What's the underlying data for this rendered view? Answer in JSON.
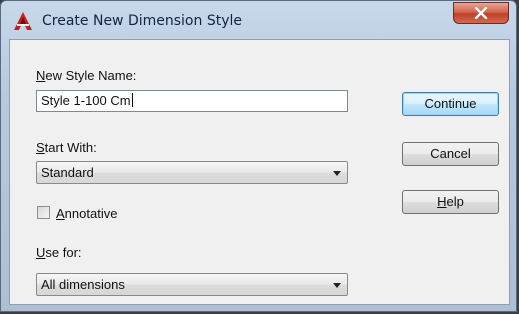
{
  "window": {
    "title": "Create New Dimension Style"
  },
  "form": {
    "new_style_name_label": "New Style Name:",
    "new_style_name_value": "Style 1-100 Cm",
    "start_with_label": "Start With:",
    "start_with_value": "Standard",
    "annotative_label": "Annotative",
    "annotative_checked": false,
    "use_for_label": "Use for:",
    "use_for_value": "All dimensions"
  },
  "buttons": {
    "continue": "Continue",
    "cancel": "Cancel",
    "help": "Help"
  },
  "colors": {
    "app_icon": "#d11a1a",
    "close_button": "#c7452f"
  },
  "icons": {
    "app": "autocad-a-icon",
    "close": "close-icon",
    "dropdown": "chevron-down-icon"
  }
}
